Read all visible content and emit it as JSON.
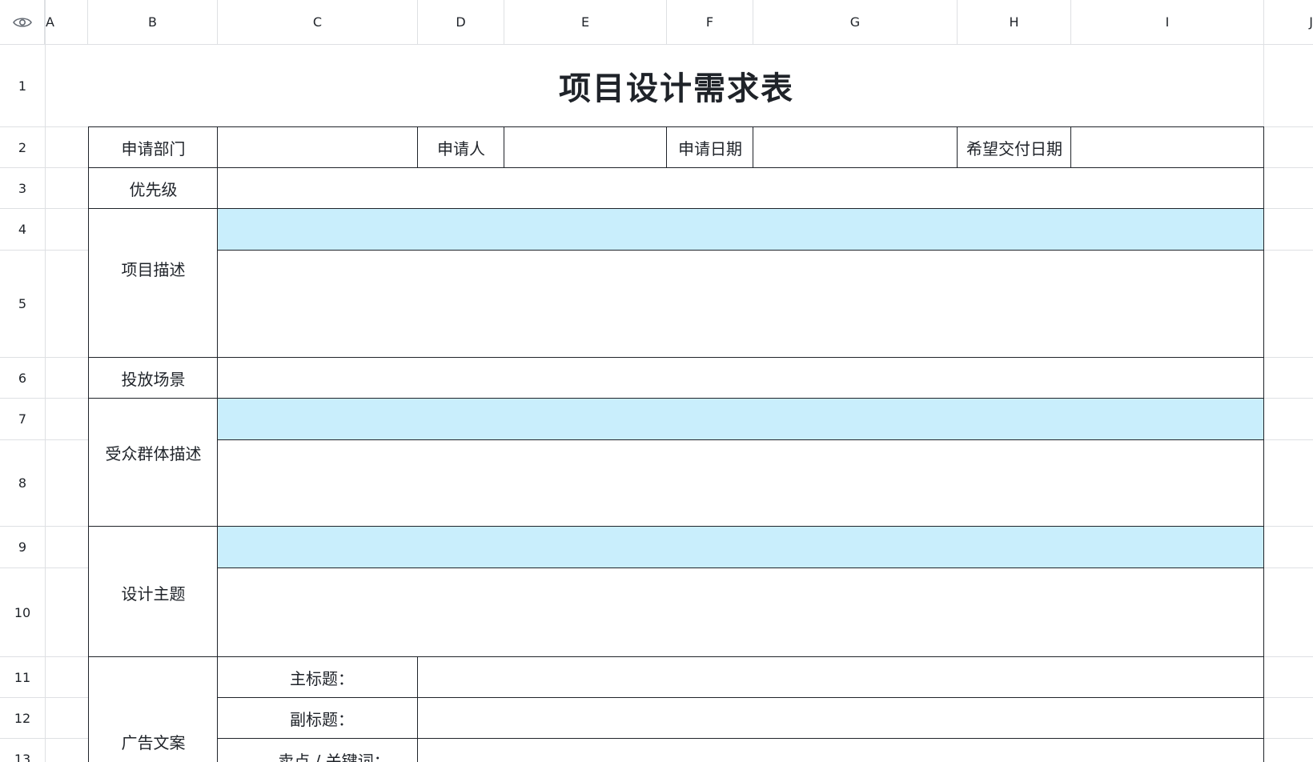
{
  "view_icon": "eye-icon",
  "columns": [
    "A",
    "B",
    "C",
    "D",
    "E",
    "F",
    "G",
    "H",
    "I",
    "J"
  ],
  "rows": [
    "1",
    "2",
    "3",
    "4",
    "5",
    "6",
    "7",
    "8",
    "9",
    "10",
    "11",
    "12",
    "13"
  ],
  "form": {
    "title": "项目设计需求表",
    "dept_label": "申请部门",
    "applicant_label": "申请人",
    "apply_date_label": "申请日期",
    "delivery_date_label": "希望交付日期",
    "priority_label": "优先级",
    "project_desc_label": "项目描述",
    "placement_label": "投放场景",
    "audience_label": "受众群体描述",
    "design_theme_label": "设计主题",
    "ad_copy_label": "广告文案",
    "main_title_label": "主标题：",
    "subtitle_label": "副标题：",
    "selling_points_label": "卖点 / 关键词："
  },
  "colors": {
    "highlight": "#c9eefc",
    "border": "#1f2329",
    "grid": "#dee0e3"
  }
}
